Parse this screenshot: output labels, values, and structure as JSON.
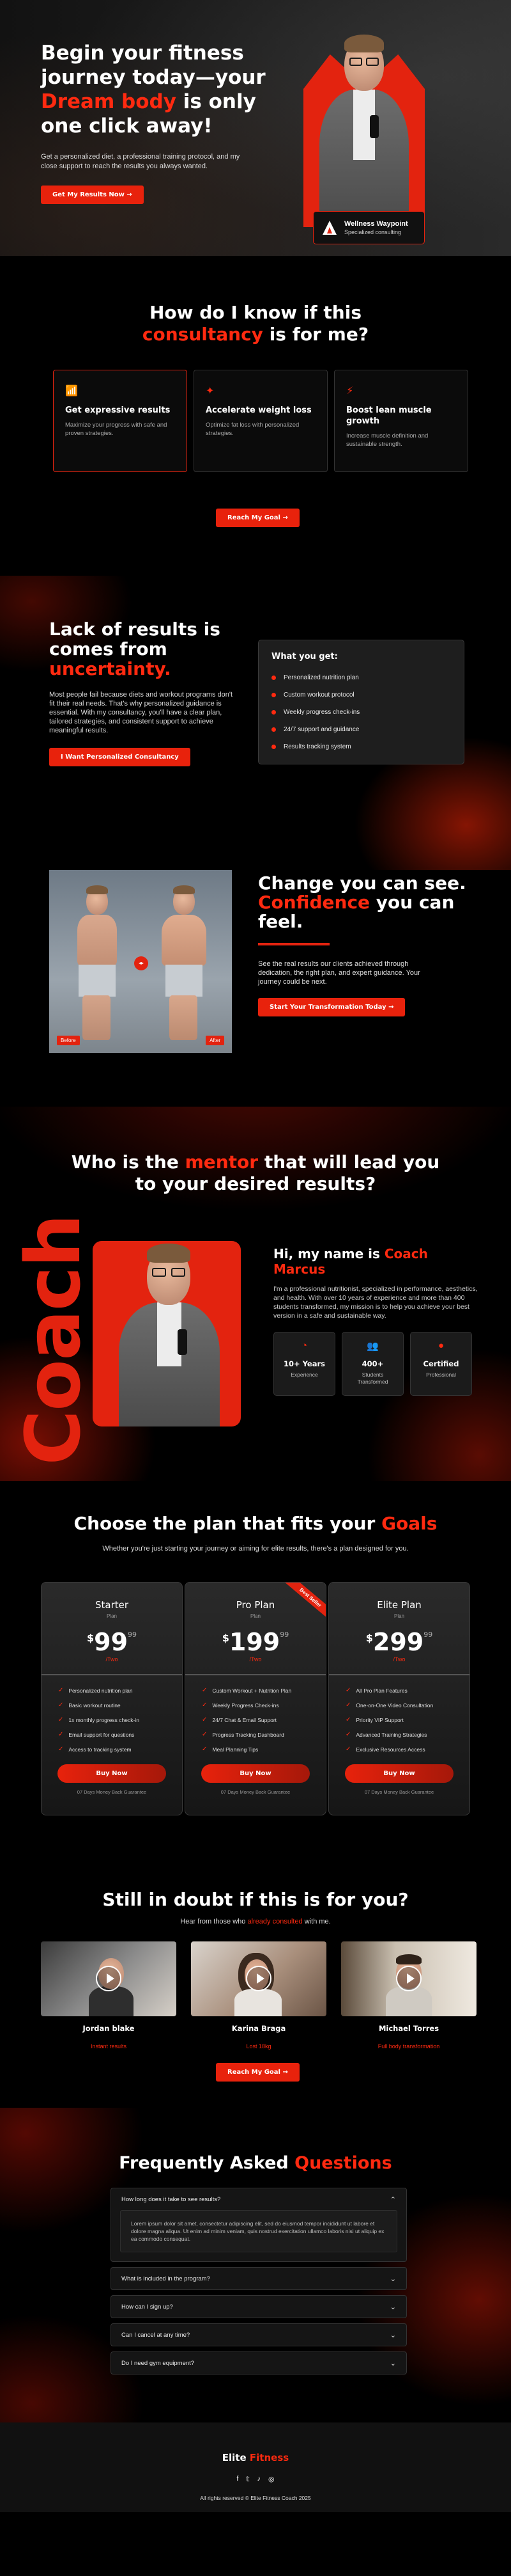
{
  "hero": {
    "title_line1": "Begin your fitness",
    "title_line2": "journey today—your",
    "title_red": "Dream body",
    "title_after_red": " is only",
    "title_line4": "one click away!",
    "paragraph": "Get a personalized diet, a professional training protocol, and my close support to reach the results you always wanted.",
    "cta": "Get My Results Now →",
    "badge_title": "Wellness Waypoint",
    "badge_sub": "Specialized consulting"
  },
  "consult": {
    "title_line1": "How do I know if this",
    "title_red": "consultancy",
    "title_after": " is for me?",
    "cards": [
      {
        "icon": "chart-bars-icon",
        "glyph": "📶",
        "title": "Get expressive results",
        "text": "Maximize your progress with safe and proven strategies."
      },
      {
        "icon": "target-icon",
        "glyph": "✦",
        "title": "Accelerate weight loss",
        "text": "Optimize fat loss with personalized strategies."
      },
      {
        "icon": "lightning-icon",
        "glyph": "⚡",
        "title": "Boost lean muscle growth",
        "text": "Increase muscle definition and sustainable strength."
      }
    ],
    "cta": "Reach My Goal →"
  },
  "uncertainty": {
    "title_line1": "Lack of results is",
    "title_line2": "comes from",
    "title_red": "uncertainty.",
    "paragraph": "Most people fail because diets and workout programs don't fit their real needs. That's why personalized guidance is essential. With my consultancy, you'll have a clear plan, tailored strategies, and consistent support to achieve meaningful results.",
    "cta": "I Want Personalized Consultancy",
    "box_title": "What you get:",
    "items": [
      "Personalized nutrition plan",
      "Custom workout protocol",
      "Weekly progress check-ins",
      "24/7 support and guidance",
      "Results tracking system"
    ]
  },
  "transformation": {
    "title_line1": "Change you can see.",
    "title_red": "Confidence",
    "title_after": " you can",
    "title_line3": "feel.",
    "paragraph": "See the real results our clients achieved through dedication, the right plan, and expert guidance. Your journey could be next.",
    "cta": "Start Your Transformation Today →",
    "before_label": "Before",
    "after_label": "After",
    "compare_glyph": "◂▸"
  },
  "mentor": {
    "title_pre": "Who is the ",
    "title_red": "mentor",
    "title_after": " that will lead you",
    "title_line2": "to your desired results?",
    "side_word": "Coach",
    "name_pre": "Hi, my name is ",
    "name_red": "Coach Marcus",
    "paragraph": "I'm a professional nutritionist, specialized in performance, aesthetics, and health. With over 10 years of experience and more than 400 students transformed, my mission is to help you achieve your best version in a safe and sustainable way.",
    "stats": [
      {
        "icon": "clock-icon",
        "glyph": "◔",
        "value": "10+ Years",
        "label": "Experience"
      },
      {
        "icon": "users-icon",
        "glyph": "👥",
        "value": "400+",
        "label": "Students Transformed"
      },
      {
        "icon": "certificate-icon",
        "glyph": "●",
        "value": "Certified",
        "label": "Professional"
      }
    ]
  },
  "pricing": {
    "title_pre": "Choose the plan that fits your ",
    "title_red": "Goals",
    "subtitle": "Whether you're just starting your journey or aiming for elite results, there's a plan designed for you.",
    "plans": [
      {
        "name": "Starter",
        "tag": "Plan",
        "currency": "$",
        "price": "99",
        "cents": "99",
        "period": "/Two",
        "ribbon": "",
        "features": [
          "Personalized nutrition plan",
          "Basic workout routine",
          "1x monthly progress check-in",
          "Email support for questions",
          "Access to tracking system"
        ],
        "cta": "Buy Now",
        "guarantee": "07 Days Money Back Guarantee"
      },
      {
        "name": "Pro Plan",
        "tag": "Plan",
        "currency": "$",
        "price": "199",
        "cents": "99",
        "period": "/Two",
        "ribbon": "Best Seller",
        "features": [
          "Custom Workout + Nutrition Plan",
          "Weekly Progress Check-ins",
          "24/7 Chat & Email Support",
          "Progress Tracking Dashboard",
          "Meal Planning Tips"
        ],
        "cta": "Buy Now",
        "guarantee": "07 Days Money Back Guarantee"
      },
      {
        "name": "Elite Plan",
        "tag": "Plan",
        "currency": "$",
        "price": "299",
        "cents": "99",
        "period": "/Two",
        "ribbon": "",
        "features": [
          "All Pro Plan Features",
          "One-on-One Video Consultation",
          "Priority VIP Support",
          "Advanced Training Strategies",
          "Exclusive Resources Access"
        ],
        "cta": "Buy Now",
        "guarantee": "07 Days Money Back Guarantee"
      }
    ]
  },
  "testimonials": {
    "title": "Still in doubt if this is for you?",
    "sub_pre": "Hear from those who ",
    "sub_red": "already consulted",
    "sub_after": " with me.",
    "items": [
      {
        "name": "Jordan blake",
        "result": "Instant results"
      },
      {
        "name": "Karina Braga",
        "result": "Lost 18kg"
      },
      {
        "name": "Michael Torres",
        "result": "Full body transformation"
      }
    ],
    "cta": "Reach My Goal →"
  },
  "faq": {
    "title_pre": "Frequently Asked ",
    "title_red": "Questions",
    "items": [
      {
        "q": "How long does it take to see results?",
        "open": true,
        "chev": "⌃",
        "a": "Lorem ipsum dolor sit amet, consectetur adipiscing elit, sed do eiusmod tempor incididunt ut labore et dolore magna aliqua. Ut enim ad minim veniam, quis nostrud exercitation ullamco laboris nisi ut aliquip ex ea commodo consequat."
      },
      {
        "q": "What is included in the program?",
        "open": false,
        "chev": "⌄",
        "a": ""
      },
      {
        "q": "How can I sign up?",
        "open": false,
        "chev": "⌄",
        "a": ""
      },
      {
        "q": "Can I cancel at any time?",
        "open": false,
        "chev": "⌄",
        "a": ""
      },
      {
        "q": "Do I need gym equipment?",
        "open": false,
        "chev": "⌄",
        "a": ""
      }
    ]
  },
  "footer": {
    "brand_pre": "Elite ",
    "brand_red": "Fitness",
    "socials": [
      {
        "icon": "facebook-icon",
        "glyph": "f"
      },
      {
        "icon": "twitter-icon",
        "glyph": "𝕥"
      },
      {
        "icon": "tiktok-icon",
        "glyph": "♪"
      },
      {
        "icon": "instagram-icon",
        "glyph": "◎"
      }
    ],
    "copyright": "All rights reserved © Elite Fitness Coach 2025"
  },
  "colors": {
    "accent": "#e3230f",
    "background": "#000000",
    "card": "#1e1e1e"
  }
}
